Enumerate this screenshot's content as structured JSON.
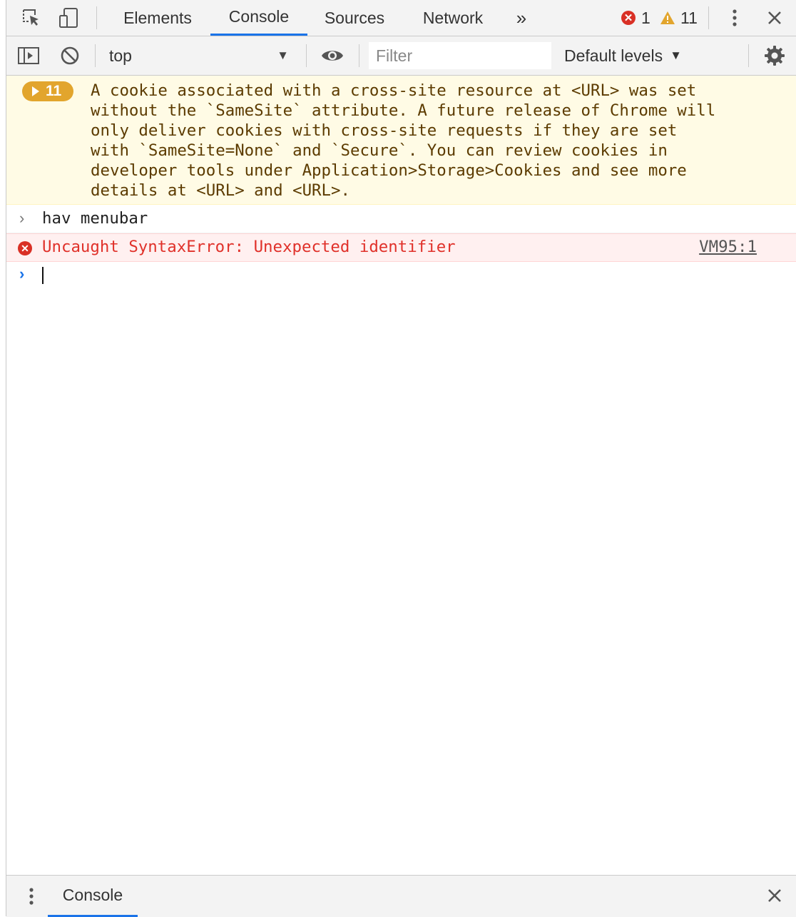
{
  "tabs": [
    {
      "label": "Elements"
    },
    {
      "label": "Console",
      "active": true
    },
    {
      "label": "Sources"
    },
    {
      "label": "Network"
    }
  ],
  "overflow_icon": "chevrons-right-icon",
  "counts": {
    "errors": "1",
    "warnings": "11"
  },
  "toolbar": {
    "context": "top",
    "filter_placeholder": "Filter",
    "levels": "Default levels"
  },
  "messages": {
    "warning": {
      "count": "11",
      "text": "A cookie associated with a cross-site resource at <URL> was set\nwithout the `SameSite` attribute. A future release of Chrome will\nonly deliver cookies with cross-site requests if they are set\nwith `SameSite=None` and `Secure`. You can review cookies in\ndeveloper tools under Application>Storage>Cookies and see more\ndetails at <URL> and <URL>."
    },
    "input": {
      "text": "hav menubar"
    },
    "error": {
      "text": "Uncaught SyntaxError: Unexpected identifier",
      "source": "VM95:1"
    }
  },
  "drawer": {
    "tab": "Console"
  },
  "colors": {
    "accent": "#1a73e8",
    "error": "#d93025",
    "warning": "#e2a52d",
    "warning_bg": "#fffbe5",
    "error_bg": "#fff0f0"
  }
}
